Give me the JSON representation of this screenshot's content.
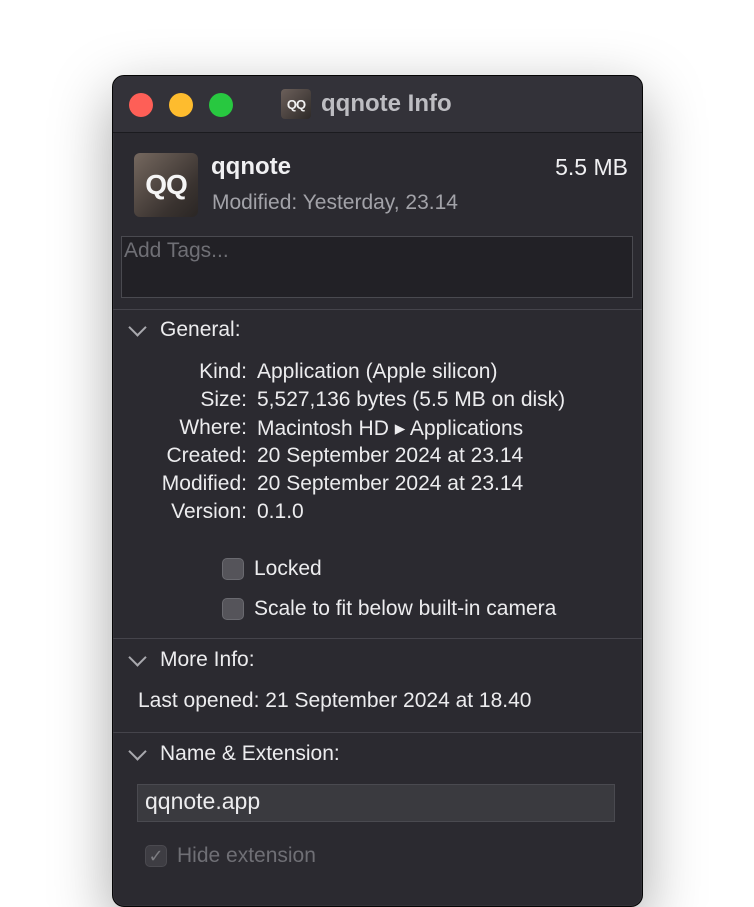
{
  "window": {
    "title": "qqnote Info",
    "icon_text": "QQ"
  },
  "header": {
    "name": "qqnote",
    "size": "5.5 MB",
    "modified_label": "Modified:",
    "modified_value": "Yesterday, 23.14"
  },
  "tags": {
    "placeholder": "Add Tags..."
  },
  "general": {
    "title": "General:",
    "rows": [
      {
        "label": "Kind:",
        "value": "Application (Apple silicon)"
      },
      {
        "label": "Size:",
        "value": "5,527,136 bytes (5.5 MB on disk)"
      },
      {
        "label": "Where:",
        "value": "Macintosh HD ▸ Applications"
      },
      {
        "label": "Created:",
        "value": "20 September 2024 at 23.14"
      },
      {
        "label": "Modified:",
        "value": "20 September 2024 at 23.14"
      },
      {
        "label": "Version:",
        "value": "0.1.0"
      }
    ],
    "locked_label": "Locked",
    "locked_checked": false,
    "scale_label": "Scale to fit below built-in camera",
    "scale_checked": false
  },
  "more_info": {
    "title": "More Info:",
    "last_opened_label": "Last opened:",
    "last_opened_value": "21 September 2024 at 18.40"
  },
  "name_extension": {
    "title": "Name & Extension:",
    "filename": "qqnote.app",
    "hide_extension_label": "Hide extension",
    "hide_extension_checked": true
  },
  "colors": {
    "window_bg": "#2b2a30",
    "close": "#fe5f57",
    "minimize": "#febc2e",
    "zoom": "#28c840"
  }
}
